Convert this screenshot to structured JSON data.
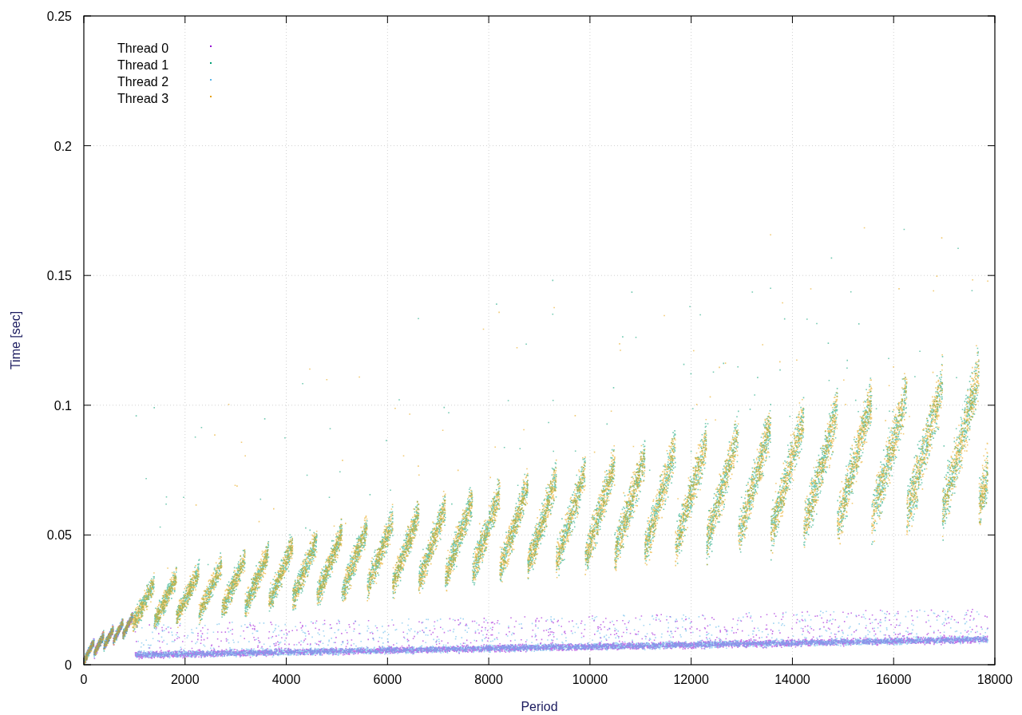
{
  "chart": {
    "xlabel": "Period",
    "ylabel": "Time [sec]",
    "xticks": [
      "0",
      "2000",
      "4000",
      "6000",
      "8000",
      "10000",
      "12000",
      "14000",
      "16000",
      "18000"
    ],
    "yticks": [
      "0.25",
      "0.2",
      "0.15",
      "0.1",
      "0.05",
      "0"
    ],
    "legend": [
      {
        "label": "Thread 0",
        "color": "#9400d3",
        "kind": "baseline"
      },
      {
        "label": "Thread 1",
        "color": "#009e73",
        "kind": "sawtooth"
      },
      {
        "label": "Thread 2",
        "color": "#56b4e9",
        "kind": "baseline"
      },
      {
        "label": "Thread 3",
        "color": "#e69f00",
        "kind": "sawtooth"
      }
    ]
  }
}
